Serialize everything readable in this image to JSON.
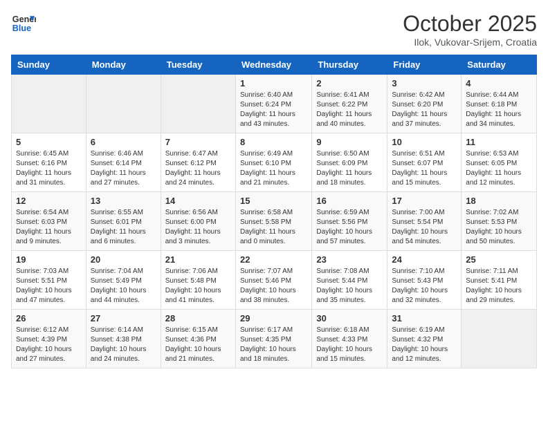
{
  "header": {
    "logo_line1": "General",
    "logo_line2": "Blue",
    "month": "October 2025",
    "location": "Ilok, Vukovar-Srijem, Croatia"
  },
  "weekdays": [
    "Sunday",
    "Monday",
    "Tuesday",
    "Wednesday",
    "Thursday",
    "Friday",
    "Saturday"
  ],
  "weeks": [
    [
      {
        "day": "",
        "info": ""
      },
      {
        "day": "",
        "info": ""
      },
      {
        "day": "",
        "info": ""
      },
      {
        "day": "1",
        "info": "Sunrise: 6:40 AM\nSunset: 6:24 PM\nDaylight: 11 hours\nand 43 minutes."
      },
      {
        "day": "2",
        "info": "Sunrise: 6:41 AM\nSunset: 6:22 PM\nDaylight: 11 hours\nand 40 minutes."
      },
      {
        "day": "3",
        "info": "Sunrise: 6:42 AM\nSunset: 6:20 PM\nDaylight: 11 hours\nand 37 minutes."
      },
      {
        "day": "4",
        "info": "Sunrise: 6:44 AM\nSunset: 6:18 PM\nDaylight: 11 hours\nand 34 minutes."
      }
    ],
    [
      {
        "day": "5",
        "info": "Sunrise: 6:45 AM\nSunset: 6:16 PM\nDaylight: 11 hours\nand 31 minutes."
      },
      {
        "day": "6",
        "info": "Sunrise: 6:46 AM\nSunset: 6:14 PM\nDaylight: 11 hours\nand 27 minutes."
      },
      {
        "day": "7",
        "info": "Sunrise: 6:47 AM\nSunset: 6:12 PM\nDaylight: 11 hours\nand 24 minutes."
      },
      {
        "day": "8",
        "info": "Sunrise: 6:49 AM\nSunset: 6:10 PM\nDaylight: 11 hours\nand 21 minutes."
      },
      {
        "day": "9",
        "info": "Sunrise: 6:50 AM\nSunset: 6:09 PM\nDaylight: 11 hours\nand 18 minutes."
      },
      {
        "day": "10",
        "info": "Sunrise: 6:51 AM\nSunset: 6:07 PM\nDaylight: 11 hours\nand 15 minutes."
      },
      {
        "day": "11",
        "info": "Sunrise: 6:53 AM\nSunset: 6:05 PM\nDaylight: 11 hours\nand 12 minutes."
      }
    ],
    [
      {
        "day": "12",
        "info": "Sunrise: 6:54 AM\nSunset: 6:03 PM\nDaylight: 11 hours\nand 9 minutes."
      },
      {
        "day": "13",
        "info": "Sunrise: 6:55 AM\nSunset: 6:01 PM\nDaylight: 11 hours\nand 6 minutes."
      },
      {
        "day": "14",
        "info": "Sunrise: 6:56 AM\nSunset: 6:00 PM\nDaylight: 11 hours\nand 3 minutes."
      },
      {
        "day": "15",
        "info": "Sunrise: 6:58 AM\nSunset: 5:58 PM\nDaylight: 11 hours\nand 0 minutes."
      },
      {
        "day": "16",
        "info": "Sunrise: 6:59 AM\nSunset: 5:56 PM\nDaylight: 10 hours\nand 57 minutes."
      },
      {
        "day": "17",
        "info": "Sunrise: 7:00 AM\nSunset: 5:54 PM\nDaylight: 10 hours\nand 54 minutes."
      },
      {
        "day": "18",
        "info": "Sunrise: 7:02 AM\nSunset: 5:53 PM\nDaylight: 10 hours\nand 50 minutes."
      }
    ],
    [
      {
        "day": "19",
        "info": "Sunrise: 7:03 AM\nSunset: 5:51 PM\nDaylight: 10 hours\nand 47 minutes."
      },
      {
        "day": "20",
        "info": "Sunrise: 7:04 AM\nSunset: 5:49 PM\nDaylight: 10 hours\nand 44 minutes."
      },
      {
        "day": "21",
        "info": "Sunrise: 7:06 AM\nSunset: 5:48 PM\nDaylight: 10 hours\nand 41 minutes."
      },
      {
        "day": "22",
        "info": "Sunrise: 7:07 AM\nSunset: 5:46 PM\nDaylight: 10 hours\nand 38 minutes."
      },
      {
        "day": "23",
        "info": "Sunrise: 7:08 AM\nSunset: 5:44 PM\nDaylight: 10 hours\nand 35 minutes."
      },
      {
        "day": "24",
        "info": "Sunrise: 7:10 AM\nSunset: 5:43 PM\nDaylight: 10 hours\nand 32 minutes."
      },
      {
        "day": "25",
        "info": "Sunrise: 7:11 AM\nSunset: 5:41 PM\nDaylight: 10 hours\nand 29 minutes."
      }
    ],
    [
      {
        "day": "26",
        "info": "Sunrise: 6:12 AM\nSunset: 4:39 PM\nDaylight: 10 hours\nand 27 minutes."
      },
      {
        "day": "27",
        "info": "Sunrise: 6:14 AM\nSunset: 4:38 PM\nDaylight: 10 hours\nand 24 minutes."
      },
      {
        "day": "28",
        "info": "Sunrise: 6:15 AM\nSunset: 4:36 PM\nDaylight: 10 hours\nand 21 minutes."
      },
      {
        "day": "29",
        "info": "Sunrise: 6:17 AM\nSunset: 4:35 PM\nDaylight: 10 hours\nand 18 minutes."
      },
      {
        "day": "30",
        "info": "Sunrise: 6:18 AM\nSunset: 4:33 PM\nDaylight: 10 hours\nand 15 minutes."
      },
      {
        "day": "31",
        "info": "Sunrise: 6:19 AM\nSunset: 4:32 PM\nDaylight: 10 hours\nand 12 minutes."
      },
      {
        "day": "",
        "info": ""
      }
    ]
  ]
}
